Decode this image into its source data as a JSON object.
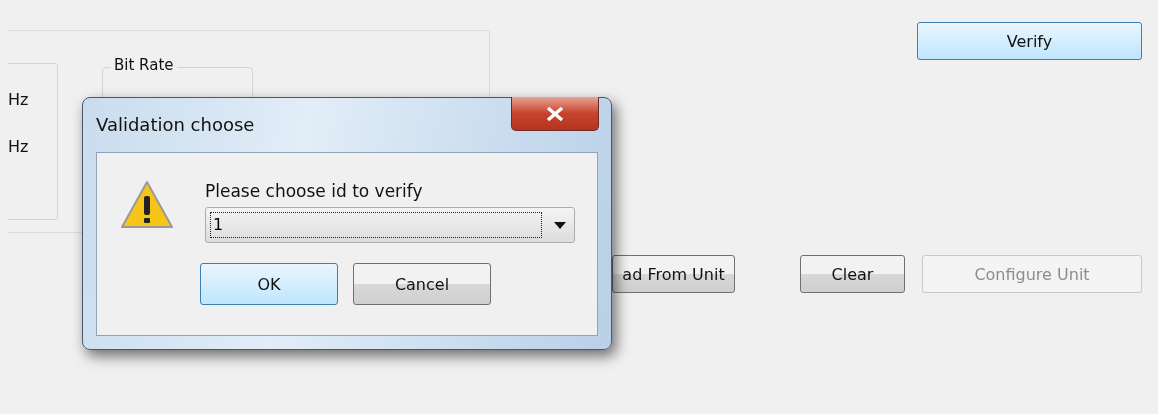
{
  "background": {
    "group_left": {
      "labels": [
        "Hz",
        "Hz"
      ]
    },
    "group_bit_rate": {
      "title": "Bit Rate"
    },
    "verify_button": {
      "label": "Verify",
      "disabled": false
    },
    "buttons": [
      {
        "label": "ad From Unit",
        "disabled": false
      },
      {
        "label": "Clear",
        "disabled": false
      },
      {
        "label": "Configure Unit",
        "disabled": true
      }
    ]
  },
  "dialog": {
    "title": "Validation choose",
    "message": "Please choose id to verify",
    "select": {
      "value": "1"
    },
    "buttons": [
      {
        "label": "OK",
        "default": true
      },
      {
        "label": "Cancel",
        "default": false
      }
    ]
  }
}
